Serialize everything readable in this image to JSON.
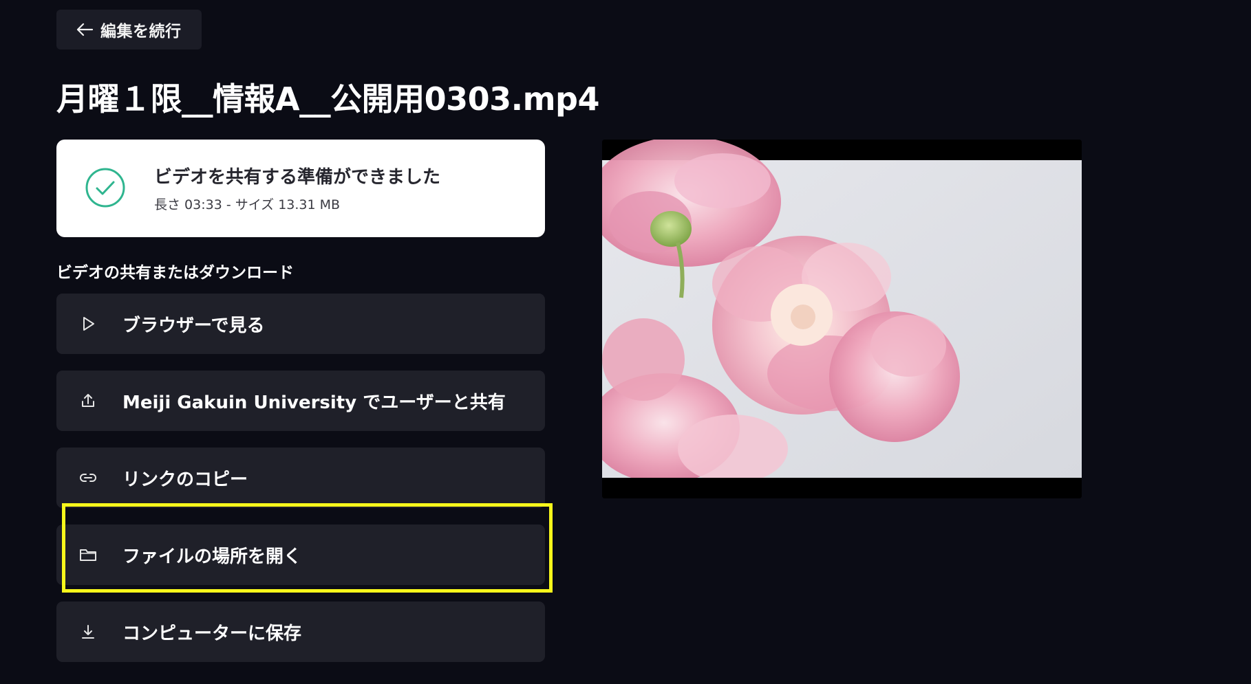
{
  "back_button": {
    "label": "編集を続行",
    "icon": "arrow-left-icon"
  },
  "title": "月曜１限__情報A__公開用0303.mp4",
  "status": {
    "icon": "check-circle-icon",
    "message": "ビデオを共有する準備ができました",
    "meta": "長さ 03:33 - サイズ 13.31 MB",
    "accent_color": "#2fb58f"
  },
  "share_section": {
    "heading": "ビデオの共有またはダウンロード",
    "actions": [
      {
        "label": "ブラウザーで見る",
        "icon": "play-icon"
      },
      {
        "label": "Meiji Gakuin University でユーザーと共有",
        "icon": "share-upload-icon"
      },
      {
        "label": "リンクのコピー",
        "icon": "link-icon"
      },
      {
        "label": "ファイルの場所を開く",
        "icon": "folder-icon"
      },
      {
        "label": "コンピューターに保存",
        "icon": "download-icon"
      }
    ]
  },
  "highlight_color": "#f7f71b",
  "preview": {
    "description_icon": "video-thumbnail"
  }
}
